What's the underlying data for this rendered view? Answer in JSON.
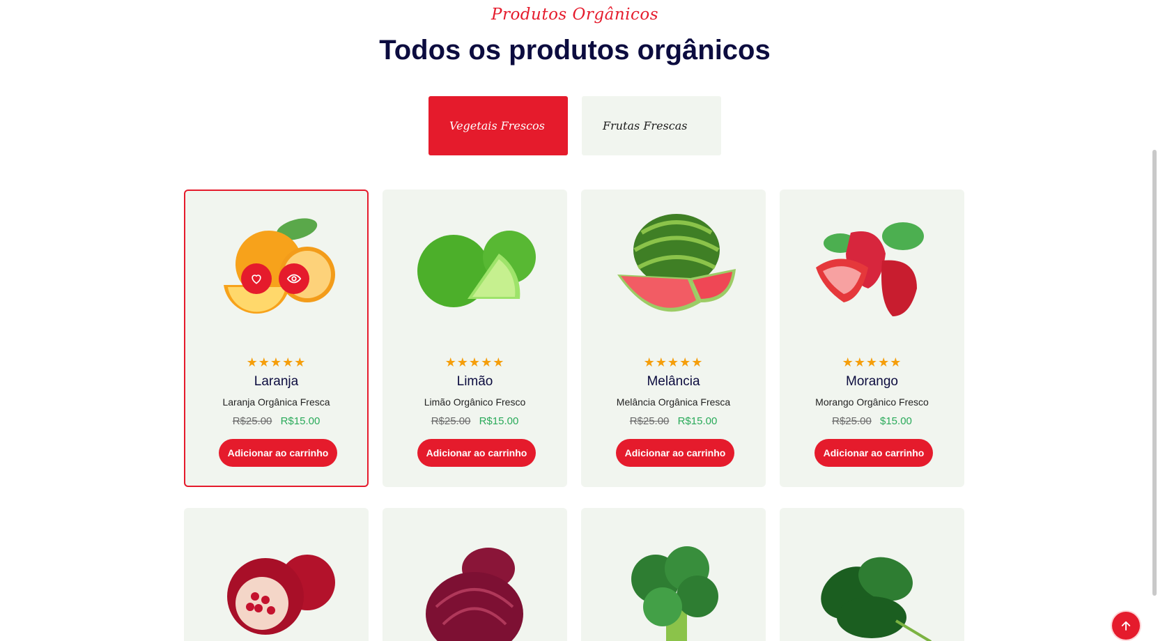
{
  "section": {
    "subtitle": "Produtos Orgânicos",
    "title": "Todos os produtos orgânicos"
  },
  "tabs": [
    {
      "label": "Vegetais Frescos",
      "active": true
    },
    {
      "label": "Frutas Frescas",
      "active": false
    }
  ],
  "products": [
    {
      "name": "Laranja",
      "desc": "Laranja Orgânica Fresca",
      "old_price": "R$25.00",
      "new_price": "R$15.00",
      "rating": 5,
      "cta": "Adicionar ao carrinho",
      "image": "orange-icon",
      "selected": true
    },
    {
      "name": "Limão",
      "desc": "Limão Orgânico Fresco",
      "old_price": "R$25.00",
      "new_price": "R$15.00",
      "rating": 5,
      "cta": "Adicionar ao carrinho",
      "image": "lime-icon"
    },
    {
      "name": "Melância",
      "desc": "Melância Orgânica Fresca",
      "old_price": "R$25.00",
      "new_price": "R$15.00",
      "rating": 5,
      "cta": "Adicionar ao carrinho",
      "image": "watermelon-icon"
    },
    {
      "name": "Morango",
      "desc": "Morango Orgânico Fresco",
      "old_price": "R$25.00",
      "new_price": "$15.00",
      "rating": 5,
      "cta": "Adicionar ao carrinho",
      "image": "strawberry-icon"
    }
  ],
  "products_row2": [
    {
      "image": "pomegranate-icon"
    },
    {
      "image": "red-onion-icon"
    },
    {
      "image": "broccoli-icon"
    },
    {
      "image": "spinach-icon"
    }
  ],
  "stars_text": "★★★★★",
  "colors": {
    "accent": "#e51b2c",
    "card_bg": "#f1f5ef",
    "price_new": "#2aaa5a",
    "star": "#f59e0b"
  }
}
